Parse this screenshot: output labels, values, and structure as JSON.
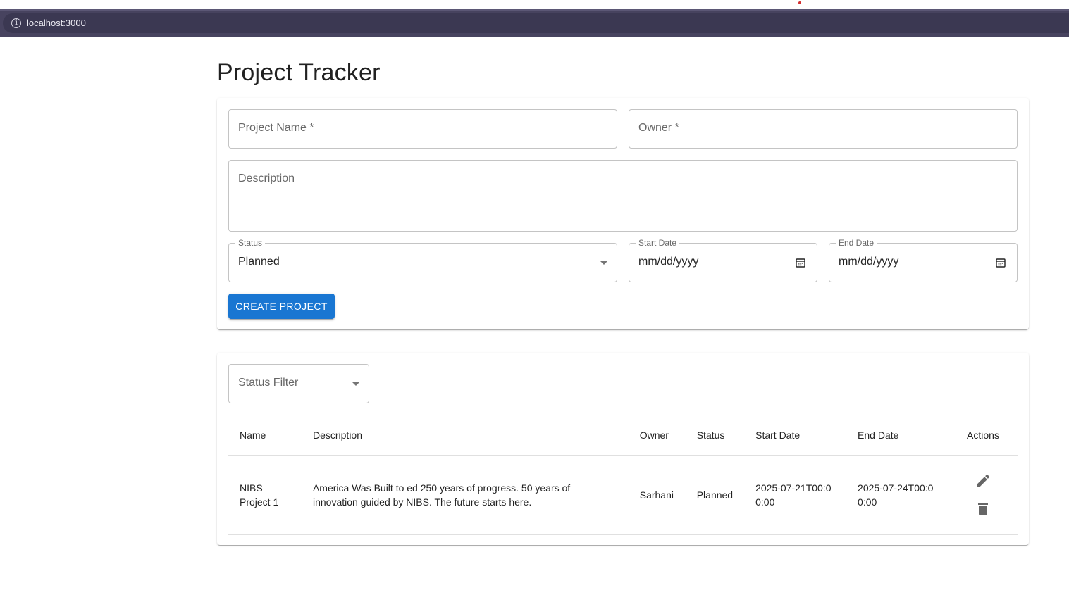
{
  "browser": {
    "url": "localhost:3000"
  },
  "page": {
    "title": "Project Tracker"
  },
  "form": {
    "project_name_placeholder": "Project Name *",
    "owner_placeholder": "Owner *",
    "description_placeholder": "Description",
    "status_label": "Status",
    "status_value": "Planned",
    "start_date_label": "Start Date",
    "start_date_value": "mm/dd/yyyy",
    "end_date_label": "End Date",
    "end_date_value": "mm/dd/yyyy",
    "create_button": "CREATE PROJECT"
  },
  "list": {
    "status_filter_placeholder": "Status Filter",
    "columns": [
      "Name",
      "Description",
      "Owner",
      "Status",
      "Start Date",
      "End Date",
      "Actions"
    ],
    "rows": [
      {
        "name": "NIBS Project 1",
        "description": "America Was Built to ed 250 years of progress. 50 years of innovation guided by NIBS. The future starts here.",
        "owner": "Sarhani",
        "status": "Planned",
        "start_date": "2025-07-21T00:00:00",
        "end_date": "2025-07-24T00:00:00",
        "actions": [
          "edit-icon",
          "delete-icon"
        ]
      }
    ]
  },
  "colors": {
    "primary": "#1976d2",
    "browser_bar": "#47435f"
  }
}
